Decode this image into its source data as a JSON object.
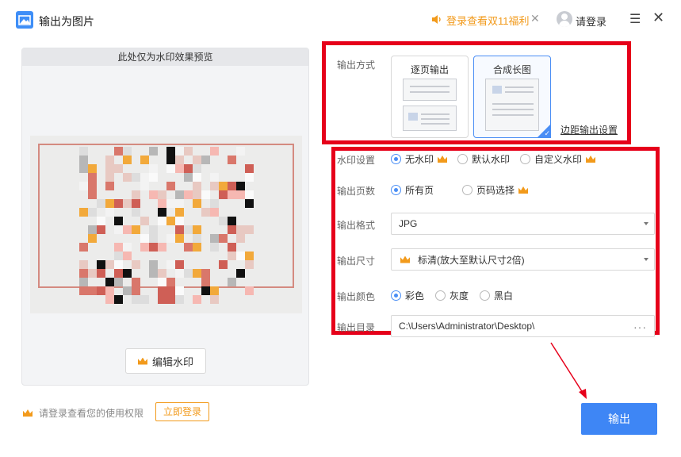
{
  "app": {
    "title": "输出为图片",
    "promo": "登录查看双11福利",
    "login": "请登录"
  },
  "preview": {
    "header": "此处仅为水印效果预览",
    "edit_button": "编辑水印"
  },
  "footer": {
    "hint": "请登录查看您的使用权限",
    "login_now": "立即登录",
    "output": "输出"
  },
  "settings": {
    "mode_label": "输出方式",
    "mode_options": [
      "逐页输出",
      "合成长图"
    ],
    "mode_selected": "合成长图",
    "margin_link": "边距输出设置",
    "watermark_label": "水印设置",
    "watermark_options": [
      "无水印",
      "默认水印",
      "自定义水印"
    ],
    "watermark_selected": "无水印",
    "pages_label": "输出页数",
    "pages_options": [
      "所有页",
      "页码选择"
    ],
    "pages_selected": "所有页",
    "format_label": "输出格式",
    "format_value": "JPG",
    "size_label": "输出尺寸",
    "size_value": "标清(放大至默认尺寸2倍)",
    "color_label": "输出颜色",
    "color_options": [
      "彩色",
      "灰度",
      "黑白"
    ],
    "color_selected": "彩色",
    "dir_label": "输出目录",
    "dir_value": "C:\\Users\\Administrator\\Desktop\\",
    "dir_more": "···"
  },
  "colors": {
    "accent": "#3e86f5",
    "vip": "#f29a1b",
    "annotation": "#e6001a"
  },
  "icons": {
    "app": "image-icon",
    "promo": "speaker-icon",
    "vip": "crown-icon",
    "user": "user-icon",
    "menu": "menu-icon",
    "close": "close-icon"
  }
}
